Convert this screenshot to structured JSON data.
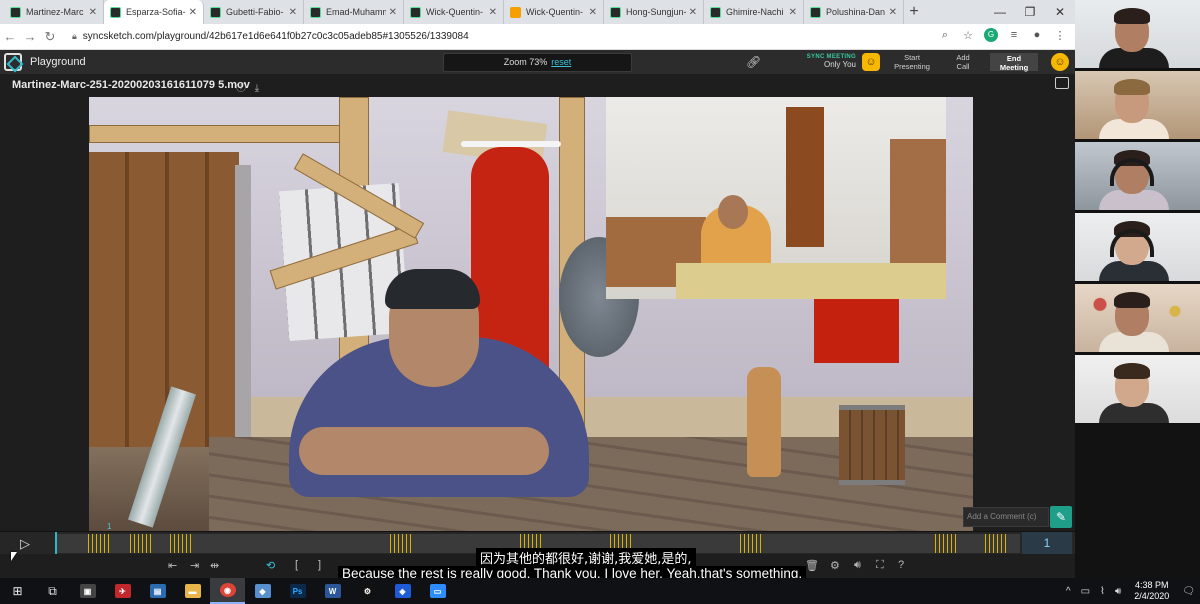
{
  "browser": {
    "tabs": [
      {
        "label": "Martinez-Marc",
        "active": false
      },
      {
        "label": "Esparza-Sofia-",
        "active": true
      },
      {
        "label": "Gubetti-Fabio-",
        "active": false
      },
      {
        "label": "Emad-Muhamm",
        "active": false
      },
      {
        "label": "Wick-Quentin-",
        "active": false
      },
      {
        "label": "Wick-Quentin-",
        "active": false
      },
      {
        "label": "Hong-Sungjun-",
        "active": false
      },
      {
        "label": "Ghimire-Nachi",
        "active": false
      },
      {
        "label": "Polushina-Dan",
        "active": false
      }
    ],
    "new_tab": "+",
    "url": "syncsketch.com/playground/42b617e1d6e641f0b27c0c3c05adeb85#1305526/1339084"
  },
  "app": {
    "title": "Playground",
    "zoom_label": "Zoom 73%",
    "zoom_reset": "reset",
    "sync_status_label": "SYNC MEETING",
    "sync_status_value": "Only You",
    "start_presenting": [
      "Start",
      "Presenting"
    ],
    "add_call": [
      "Add",
      "Call"
    ],
    "end_meeting": [
      "End",
      "Meeting"
    ]
  },
  "file": {
    "name": "Martinez-Marc-251-20200203161611079 5.mov"
  },
  "comment": {
    "placeholder": "Add a Comment (c)"
  },
  "timeline": {
    "playhead_frame": "1",
    "current_frame": "1"
  },
  "subtitles": {
    "zh": "因为其他的都很好,谢谢,我爱她,是的,",
    "en": "Because the rest is really good, Thank you, I love her, Yeah,that's something,"
  },
  "taskbar": {
    "time": "4:38 PM",
    "date": "2/4/2020"
  },
  "colors": {
    "accent": "#3bc1d9",
    "sync_green": "#38c9a0",
    "smile_yellow": "#f6b800",
    "timeline_marker": "#d8b300"
  }
}
